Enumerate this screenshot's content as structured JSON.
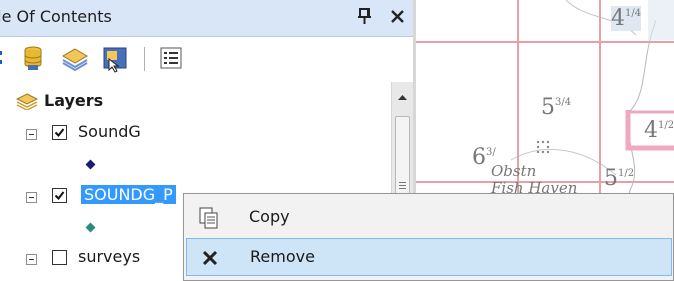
{
  "toc": {
    "title": "ble Of Contents",
    "pin_icon": "pin-icon",
    "close_icon": "close-icon",
    "toolbar": [
      {
        "name": "list-by-drawing-order-icon"
      },
      {
        "name": "list-by-source-icon"
      },
      {
        "name": "list-by-visibility-icon"
      },
      {
        "name": "list-by-selection-icon"
      },
      {
        "name": "options-icon"
      }
    ],
    "root_label": "Layers",
    "layers": [
      {
        "label": "SoundG",
        "checked": true,
        "selected": false,
        "symbol_color": "#1a1a78"
      },
      {
        "label": "SOUNDG_P",
        "checked": true,
        "selected": true,
        "symbol_color": "#2a8c80"
      },
      {
        "label": "surveys",
        "checked": false,
        "selected": false
      }
    ]
  },
  "map": {
    "labels": [
      {
        "text": "4",
        "sub": "1/4"
      },
      {
        "text": "5",
        "sub": "3/4"
      },
      {
        "text": "6",
        "sub": "3/"
      },
      {
        "text": "4",
        "sub": "1/2"
      },
      {
        "text": "5",
        "sub": "1/2"
      },
      {
        "text": "Obstn"
      },
      {
        "text": "Fish Haven"
      }
    ]
  },
  "context_menu": {
    "items": [
      {
        "label": "Copy",
        "icon": "copy-icon",
        "highlighted": false
      },
      {
        "label": "Remove",
        "icon": "remove-icon",
        "highlighted": true
      }
    ]
  },
  "colors": {
    "titlebar": "#d9e6f8",
    "selection": "#3399ff",
    "menu_highlight": "#cde5f7",
    "map_grid": "#e8a0a8"
  }
}
